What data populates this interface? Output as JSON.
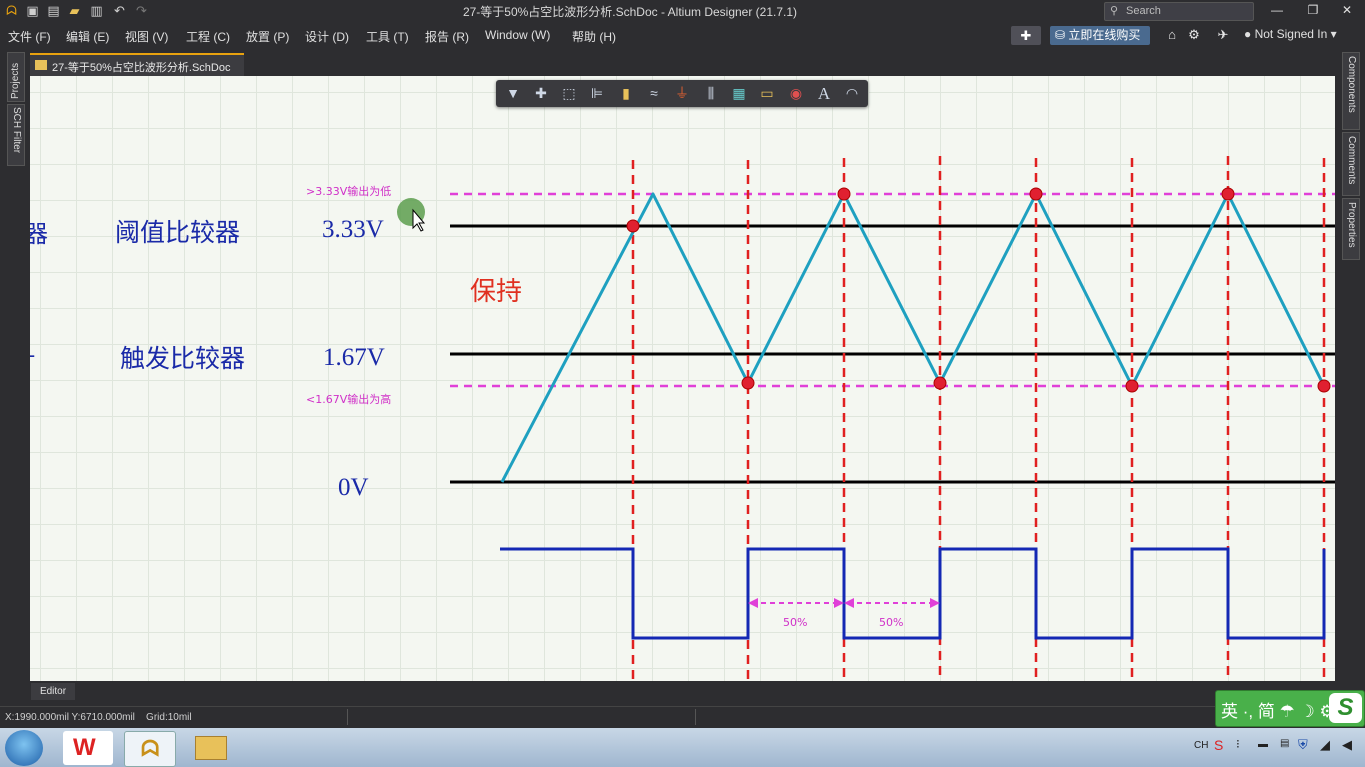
{
  "window": {
    "title": "27-等于50%占空比波形分析.SchDoc - Altium Designer (21.7.1)",
    "search_placeholder": "Search",
    "controls": [
      "—",
      "❐",
      "✕"
    ]
  },
  "menu": {
    "items": [
      "文件 (F)",
      "编辑 (E)",
      "视图 (V)",
      "工程 (C)",
      "放置 (P)",
      "设计 (D)",
      "工具 (T)",
      "报告 (R)",
      "Window (W)",
      "帮助 (H)"
    ],
    "buy_label": "立即在线购买",
    "user_label": "Not Signed In"
  },
  "panels": {
    "left": [
      "Projects",
      "SCH Filter"
    ],
    "right": [
      "Components",
      "Comments",
      "Properties"
    ]
  },
  "document_tab": "27-等于50%占空比波形分析.SchDoc",
  "bottom": {
    "editor_tab": "Editor",
    "status_coords": "X:1990.000mil Y:6710.000mil",
    "status_grid": "Grid:10mil"
  },
  "schematic": {
    "labels": {
      "threshold_comparator": "阈值比较器",
      "trigger_comparator": "触发比较器",
      "v_high": "3.33V",
      "v_low": "1.67V",
      "v_zero": "0V",
      "note_high": ">3.33V输出为低",
      "note_low": "<1.67V输出为高",
      "hold": "保持",
      "duty1": "50%",
      "duty2": "50%",
      "cut_left_1": "器",
      "cut_left_2": "-"
    },
    "colors": {
      "triangle": "#1ea0c0",
      "square": "#1428b4",
      "dashed_red": "#e02020",
      "dashed_magenta": "#e040d8",
      "label_blue": "#1a2aa8",
      "hold_red": "#e03020",
      "note_magenta": "#d030c8",
      "marker": "#e02030"
    }
  },
  "ime": {
    "text": "英 ·, 简 ☂ ☽ ⚙"
  },
  "tray": {
    "lang": "CH"
  }
}
